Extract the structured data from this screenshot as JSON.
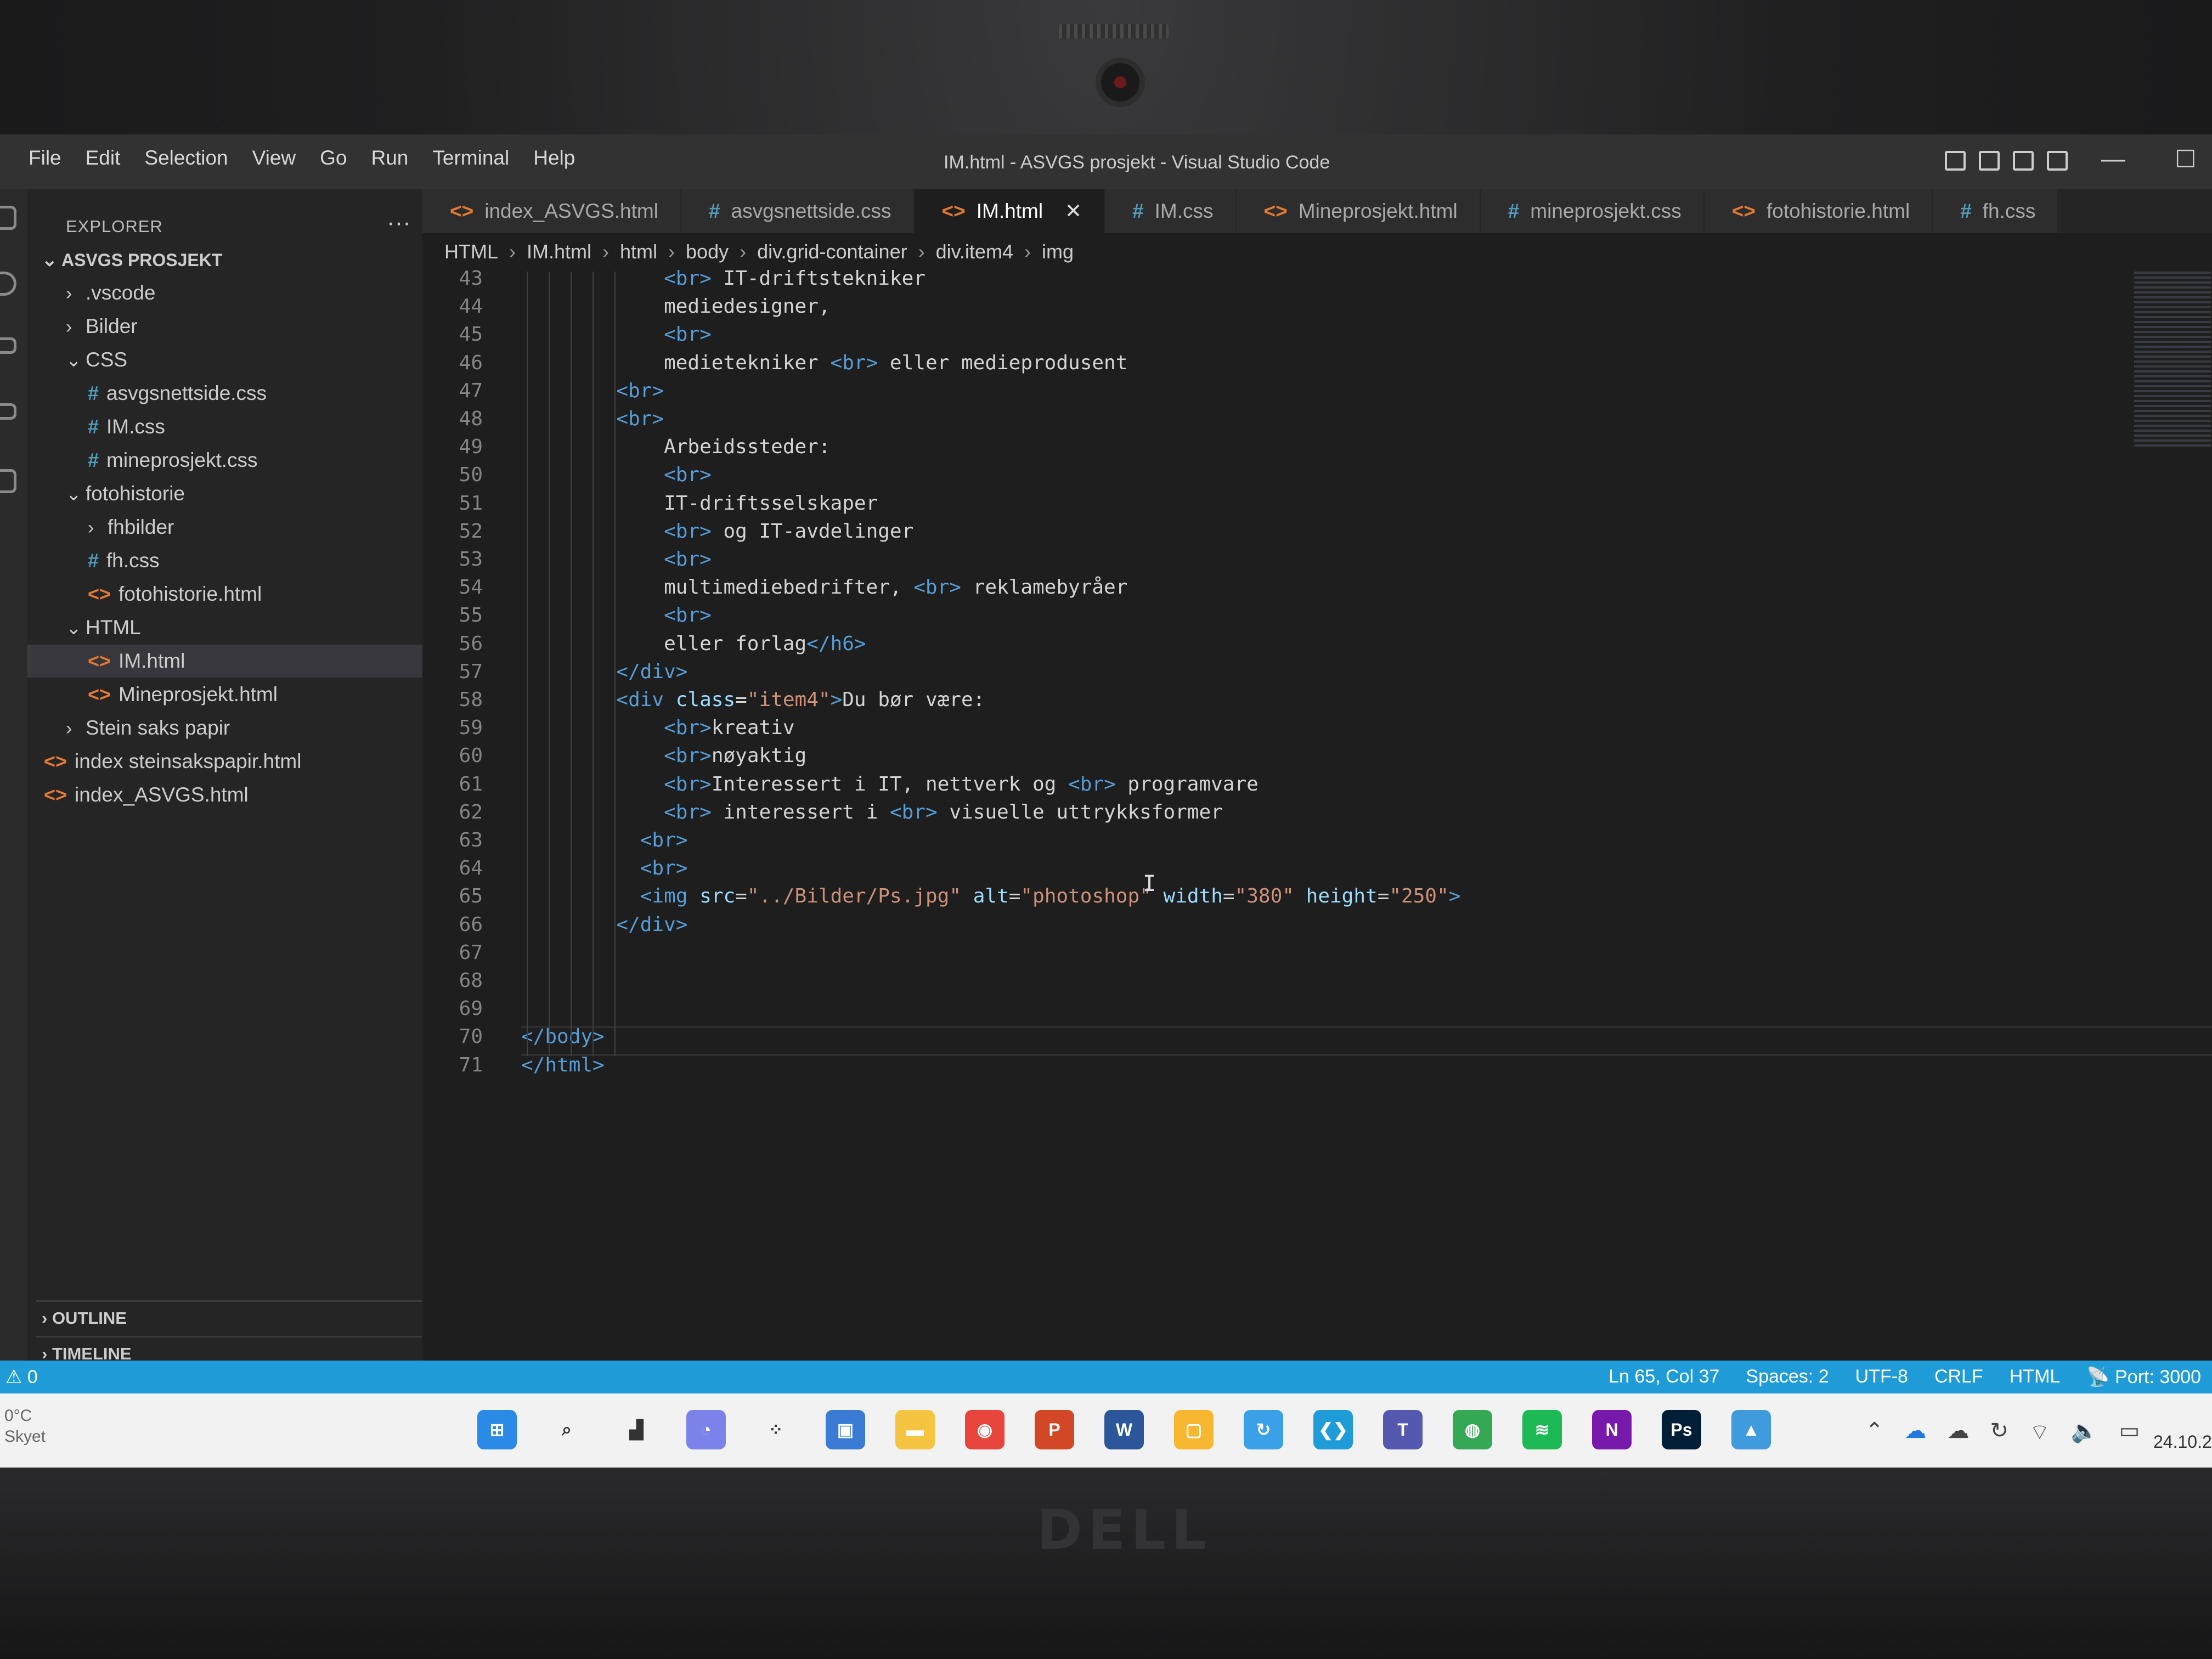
{
  "window": {
    "title": "IM.html - ASVGS prosjekt - Visual Studio Code",
    "menu": [
      "File",
      "Edit",
      "Selection",
      "View",
      "Go",
      "Run",
      "Terminal",
      "Help"
    ]
  },
  "sidebar": {
    "header": "EXPLORER",
    "more": "···",
    "root": "ASVGS PROSJEKT",
    "items": [
      {
        "label": ".vscode",
        "kind": "folder",
        "expanded": false
      },
      {
        "label": "Bilder",
        "kind": "folder",
        "expanded": false
      },
      {
        "label": "CSS",
        "kind": "folder",
        "expanded": true
      },
      {
        "label": "asvgsnettside.css",
        "kind": "css"
      },
      {
        "label": "IM.css",
        "kind": "css"
      },
      {
        "label": "mineprosjekt.css",
        "kind": "css"
      },
      {
        "label": "fotohistorie",
        "kind": "folder",
        "expanded": true
      },
      {
        "label": "fhbilder",
        "kind": "folder",
        "expanded": false
      },
      {
        "label": "fh.css",
        "kind": "css"
      },
      {
        "label": "fotohistorie.html",
        "kind": "html"
      },
      {
        "label": "HTML",
        "kind": "folder",
        "expanded": true
      },
      {
        "label": "IM.html",
        "kind": "html",
        "selected": true
      },
      {
        "label": "Mineprosjekt.html",
        "kind": "html"
      },
      {
        "label": "Stein saks papir",
        "kind": "folder",
        "expanded": false
      },
      {
        "label": "index steinsakspapir.html",
        "kind": "html"
      },
      {
        "label": "index_ASVGS.html",
        "kind": "html"
      }
    ],
    "outline": "OUTLINE",
    "timeline": "TIMELINE"
  },
  "tabs": [
    {
      "label": "index_ASVGS.html",
      "kind": "html"
    },
    {
      "label": "asvgsnettside.css",
      "kind": "css"
    },
    {
      "label": "IM.html",
      "kind": "html",
      "active": true
    },
    {
      "label": "IM.css",
      "kind": "css"
    },
    {
      "label": "Mineprosjekt.html",
      "kind": "html"
    },
    {
      "label": "mineprosjekt.css",
      "kind": "css"
    },
    {
      "label": "fotohistorie.html",
      "kind": "html"
    },
    {
      "label": "fh.css",
      "kind": "css"
    }
  ],
  "breadcrumb": [
    "HTML",
    "IM.html",
    "html",
    "body",
    "div.grid-container",
    "div.item4",
    "img"
  ],
  "editor": {
    "lines": [
      {
        "n": "43",
        "code": "            <br> IT-driftstekniker"
      },
      {
        "n": "44",
        "code": "            mediedesigner,"
      },
      {
        "n": "45",
        "code": "            <br>"
      },
      {
        "n": "46",
        "code": "            medietekniker <br> eller medieprodusent"
      },
      {
        "n": "47",
        "code": "        <br>"
      },
      {
        "n": "48",
        "code": "        <br>"
      },
      {
        "n": "49",
        "code": "            Arbeidssteder:"
      },
      {
        "n": "50",
        "code": "            <br>"
      },
      {
        "n": "51",
        "code": "            IT-driftsselskaper"
      },
      {
        "n": "52",
        "code": "            <br> og IT-avdelinger"
      },
      {
        "n": "53",
        "code": "            <br>"
      },
      {
        "n": "54",
        "code": "            multimediebedrifter, <br> reklamebyråer"
      },
      {
        "n": "55",
        "code": "            <br>"
      },
      {
        "n": "56",
        "code": "            eller forlag</h6>"
      },
      {
        "n": "57",
        "code": "        </div>"
      },
      {
        "n": "58",
        "code": "        <div class=\"item4\">Du bør være:"
      },
      {
        "n": "59",
        "code": "            <br>kreativ"
      },
      {
        "n": "60",
        "code": "            <br>nøyaktig"
      },
      {
        "n": "61",
        "code": "            <br>Interessert i IT, nettverk og <br> programvare"
      },
      {
        "n": "62",
        "code": "            <br> interessert i <br> visuelle uttrykksformer"
      },
      {
        "n": "63",
        "code": "          <br>"
      },
      {
        "n": "64",
        "code": "          <br>"
      },
      {
        "n": "65",
        "code": "          <img src=\"../Bilder/Ps.jpg\" alt=\"photoshop\" width=\"380\" height=\"250\">"
      },
      {
        "n": "66",
        "code": "        </div>"
      },
      {
        "n": "67",
        "code": ""
      },
      {
        "n": "68",
        "code": ""
      },
      {
        "n": "69",
        "code": ""
      },
      {
        "n": "70",
        "code": "</body>"
      },
      {
        "n": "71",
        "code": "</html>"
      }
    ]
  },
  "statusbar": {
    "problems": "⚠ 0",
    "position": "Ln 65, Col 37",
    "spaces": "Spaces: 2",
    "encoding": "UTF-8",
    "eol": "CRLF",
    "language": "HTML",
    "port": "Port: 3000"
  },
  "taskbar": {
    "weather_temp": "0°C",
    "weather_desc": "Skyet",
    "date": "24.10.2",
    "apps": [
      {
        "name": "windows-start-icon",
        "color": "#2b8ae6",
        "glyph": "⊞"
      },
      {
        "name": "search-icon",
        "color": "#f2f2f3",
        "glyph": "⌕"
      },
      {
        "name": "task-view-icon",
        "color": "#f2f2f3",
        "glyph": "▟"
      },
      {
        "name": "chat-icon",
        "color": "#7b83eb",
        "glyph": "◔"
      },
      {
        "name": "widgets-icon",
        "color": "#f2f2f3",
        "glyph": "⁘"
      },
      {
        "name": "store-icon",
        "color": "#3a7bd5",
        "glyph": "▣"
      },
      {
        "name": "file-explorer-icon",
        "color": "#f5c542",
        "glyph": "▬"
      },
      {
        "name": "chrome-icon",
        "color": "#e8453c",
        "glyph": "◉"
      },
      {
        "name": "powerpoint-icon",
        "color": "#d24726",
        "glyph": "P"
      },
      {
        "name": "word-icon",
        "color": "#2b579a",
        "glyph": "W"
      },
      {
        "name": "notes-icon",
        "color": "#f7b731",
        "glyph": "▢"
      },
      {
        "name": "update-icon",
        "color": "#3aa0e8",
        "glyph": "↻"
      },
      {
        "name": "vscode-icon",
        "color": "#1f9cd8",
        "glyph": "❮❯"
      },
      {
        "name": "teams-icon",
        "color": "#5558af",
        "glyph": "T"
      },
      {
        "name": "chrome-alt-icon",
        "color": "#34a853",
        "glyph": "◍"
      },
      {
        "name": "spotify-icon",
        "color": "#1db954",
        "glyph": "≋"
      },
      {
        "name": "onenote-icon",
        "color": "#7719aa",
        "glyph": "N"
      },
      {
        "name": "photoshop-icon",
        "color": "#001e36",
        "glyph": "Ps"
      },
      {
        "name": "photos-icon",
        "color": "#3f9bdc",
        "glyph": "▲"
      }
    ]
  },
  "colors": {
    "statusbar": "#1f9cd8",
    "editor_bg": "#1e1e1e",
    "sidebar_bg": "#252526",
    "tag": "#569cd6",
    "attribute": "#9cdcfe",
    "string": "#ce9178"
  }
}
